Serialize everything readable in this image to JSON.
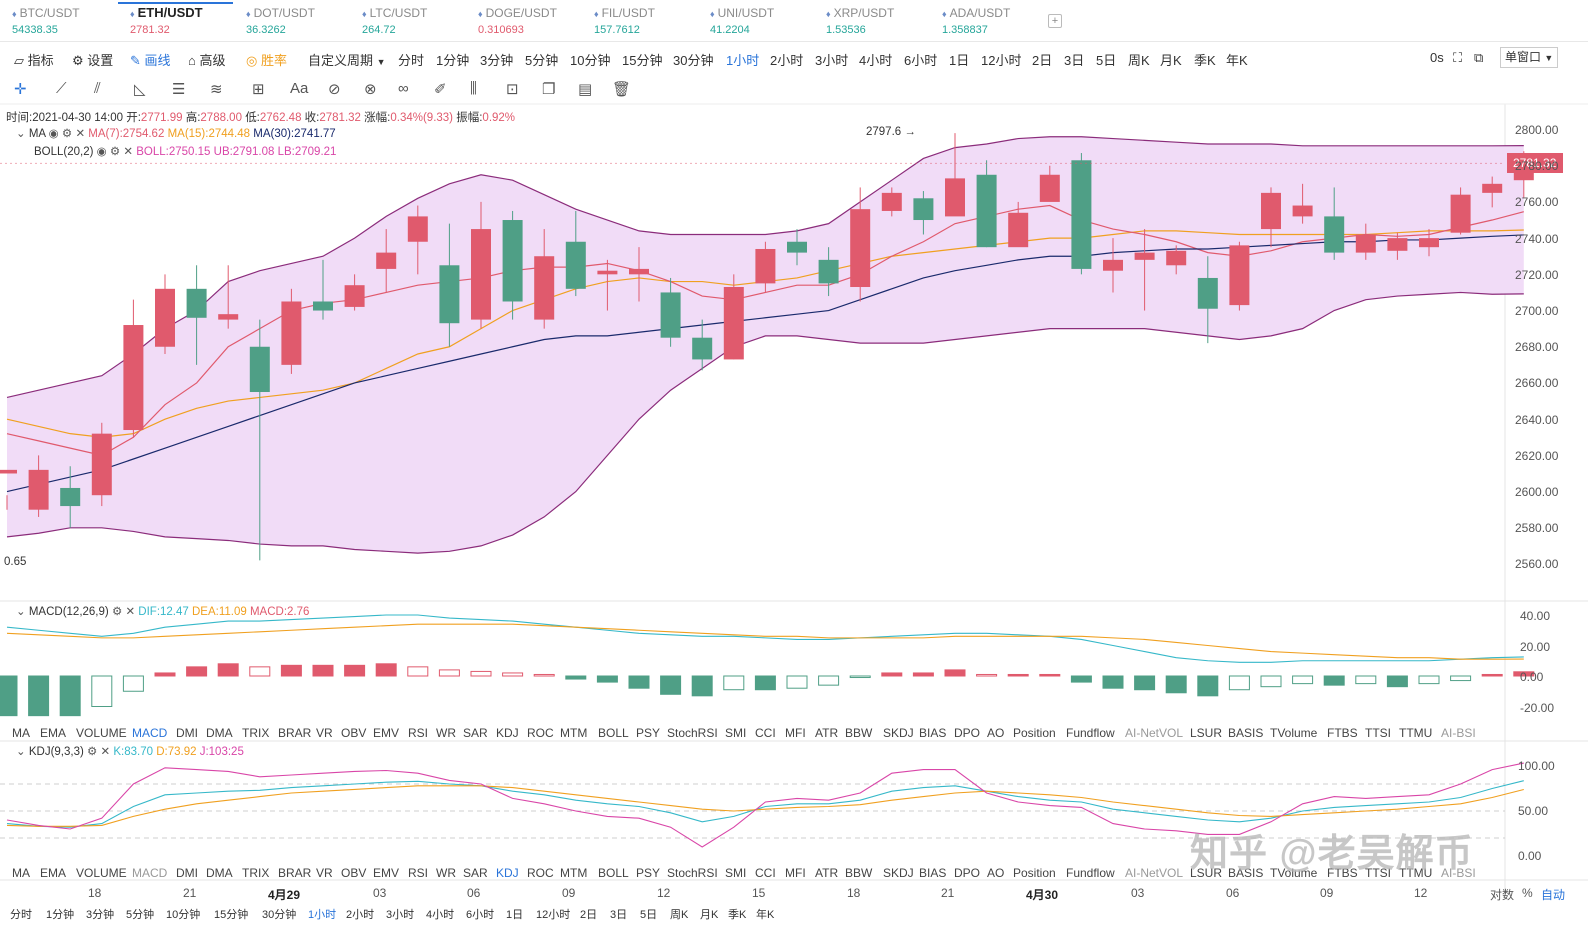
{
  "tabs": [
    {
      "symbol": "BTC/USDT",
      "price": "54338.35",
      "dir": "up"
    },
    {
      "symbol": "ETH/USDT",
      "price": "2781.32",
      "dir": "down",
      "active": true
    },
    {
      "symbol": "DOT/USDT",
      "price": "36.3262",
      "dir": "up"
    },
    {
      "symbol": "LTC/USDT",
      "price": "264.72",
      "dir": "up"
    },
    {
      "symbol": "DOGE/USDT",
      "price": "0.310693",
      "dir": "down"
    },
    {
      "symbol": "FIL/USDT",
      "price": "157.7612",
      "dir": "up"
    },
    {
      "symbol": "UNI/USDT",
      "price": "41.2204",
      "dir": "up"
    },
    {
      "symbol": "XRP/USDT",
      "price": "1.53536",
      "dir": "up"
    },
    {
      "symbol": "ADA/USDT",
      "price": "1.358837",
      "dir": "up"
    }
  ],
  "add_tab": "+",
  "toolbar": {
    "indicator": "指标",
    "settings": "设置",
    "draw": "画线",
    "advanced": "高级",
    "winrate": "胜率",
    "custom_period": "自定义周期",
    "periods": [
      "分时",
      "1分钟",
      "3分钟",
      "5分钟",
      "10分钟",
      "15分钟",
      "30分钟",
      "1小时",
      "2小时",
      "3小时",
      "4小时",
      "6小时",
      "1日",
      "12小时",
      "2日",
      "3日",
      "5日",
      "周K",
      "月K",
      "季K",
      "年K"
    ],
    "active_period": "1小时",
    "latency": "0s",
    "window_mode": "单窗口"
  },
  "ohlc": {
    "time_label": "时间:",
    "time": "2021-04-30 14:00",
    "open_label": "开:",
    "open": "2771.99",
    "high_label": "高:",
    "high": "2788.00",
    "low_label": "低:",
    "low": "2762.48",
    "close_label": "收:",
    "close": "2781.32",
    "change_label": "涨幅:",
    "change": "0.34%(9.33)",
    "amp_label": "振幅:",
    "amp": "0.92%"
  },
  "ma": {
    "name": "MA",
    "ma7": "MA(7):2754.62",
    "ma15": "MA(15):2744.48",
    "ma30": "MA(30):2741.77"
  },
  "boll": {
    "name": "BOLL(20,2)",
    "mid": "BOLL:2750.15",
    "ub": "UB:2791.08",
    "lb": "LB:2709.21"
  },
  "macd_info": {
    "name": "MACD(12,26,9)",
    "dif": "DIF:12.47",
    "dea": "DEA:11.09",
    "macd": "MACD:2.76"
  },
  "kdj_info": {
    "name": "KDJ(9,3,3)",
    "k": "K:83.70",
    "d": "D:73.92",
    "j": "J:103:25"
  },
  "indicator_tabs": [
    "MA",
    "EMA",
    "VOLUME",
    "MACD",
    "DMI",
    "DMA",
    "TRIX",
    "BRAR",
    "VR",
    "OBV",
    "EMV",
    "RSI",
    "WR",
    "SAR",
    "KDJ",
    "ROC",
    "MTM",
    "BOLL",
    "PSY",
    "StochRSI",
    "SMI",
    "CCI",
    "MFI",
    "ATR",
    "BBW",
    "SKDJ",
    "BIAS",
    "DPO",
    "AO",
    "Position",
    "Fundflow",
    "AI-NetVOL",
    "LSUR",
    "BASIS",
    "TVolume",
    "FTBS",
    "TTSI",
    "TTMU",
    "AI-BSI"
  ],
  "high_marker": "2797.6 →",
  "low_marker": "0.65",
  "last_price_tag": "2781.32",
  "price_axis": [
    "2800.00",
    "2780.00",
    "2760.00",
    "2740.00",
    "2720.00",
    "2700.00",
    "2680.00",
    "2660.00",
    "2640.00",
    "2620.00",
    "2600.00",
    "2580.00",
    "2560.00"
  ],
  "macd_axis": [
    "40.00",
    "20.00",
    "0.00",
    "-20.00"
  ],
  "kdj_axis": [
    "100.00",
    "50.00",
    "0.00"
  ],
  "time_axis": [
    "18",
    "21",
    "4月29",
    "03",
    "06",
    "09",
    "12",
    "15",
    "18",
    "21",
    "4月30",
    "03",
    "06",
    "09",
    "12"
  ],
  "axis_controls": {
    "log": "对数",
    "pct": "%",
    "auto": "自动"
  },
  "bottom_periods": [
    "分时",
    "1分钟",
    "3分钟",
    "5分钟",
    "10分钟",
    "15分钟",
    "30分钟",
    "1小时",
    "2小时",
    "3小时",
    "4小时",
    "6小时",
    "1日",
    "12小时",
    "2日",
    "3日",
    "5日",
    "周K",
    "月K",
    "季K",
    "年K"
  ],
  "watermark": "知乎 @老吴解币",
  "colors": {
    "up": "#e05a6d",
    "down": "#4f9f86",
    "band": "#f1dcf7",
    "band_line": "#8b2c7b",
    "ma7": "#e05a6d",
    "ma15": "#f0a020",
    "ma30": "#1a2a6c",
    "accent": "#2a74d9"
  },
  "chart_data": {
    "type": "candlestick",
    "interval": "1h",
    "price_range": [
      2548,
      2808
    ],
    "candles": [
      [
        2610,
        2612,
        2598,
        2590
      ],
      [
        2590,
        2612,
        2620,
        2586
      ],
      [
        2602,
        2592,
        2614,
        2580
      ],
      [
        2598,
        2632,
        2638,
        2592
      ],
      [
        2634,
        2692,
        2706,
        2630
      ],
      [
        2680,
        2712,
        2720,
        2676
      ],
      [
        2712,
        2696,
        2725,
        2670
      ],
      [
        2695,
        2698,
        2725,
        2690
      ],
      [
        2680,
        2655,
        2695,
        2562
      ],
      [
        2670,
        2705,
        2712,
        2665
      ],
      [
        2705,
        2700,
        2728,
        2695
      ],
      [
        2702,
        2714,
        2720,
        2700
      ],
      [
        2723,
        2732,
        2745,
        2710
      ],
      [
        2738,
        2752,
        2758,
        2720
      ],
      [
        2725,
        2693,
        2748,
        2680
      ],
      [
        2695,
        2745,
        2760,
        2690
      ],
      [
        2750,
        2705,
        2755,
        2695
      ],
      [
        2695,
        2730,
        2745,
        2690
      ],
      [
        2738,
        2712,
        2755,
        2708
      ],
      [
        2720,
        2722,
        2728,
        2700
      ],
      [
        2720,
        2723,
        2735,
        2705
      ],
      [
        2710,
        2685,
        2718,
        2680
      ],
      [
        2685,
        2673,
        2695,
        2667
      ],
      [
        2673,
        2713,
        2720,
        2673
      ],
      [
        2715,
        2734,
        2738,
        2710
      ],
      [
        2738,
        2732,
        2745,
        2725
      ],
      [
        2728,
        2715,
        2735,
        2708
      ],
      [
        2713,
        2756,
        2768,
        2705
      ],
      [
        2755,
        2765,
        2768,
        2752
      ],
      [
        2762,
        2750,
        2766,
        2742
      ],
      [
        2752,
        2773,
        2798,
        2755
      ],
      [
        2775,
        2735,
        2783,
        2735
      ],
      [
        2735,
        2754,
        2760,
        2742
      ],
      [
        2760,
        2775,
        2780,
        2762
      ],
      [
        2783,
        2723,
        2787,
        2720
      ],
      [
        2722,
        2728,
        2740,
        2710
      ],
      [
        2728,
        2732,
        2745,
        2700
      ],
      [
        2725,
        2733,
        2736,
        2720
      ],
      [
        2718,
        2701,
        2730,
        2682
      ],
      [
        2703,
        2736,
        2738,
        2700
      ],
      [
        2745,
        2765,
        2768,
        2735
      ],
      [
        2752,
        2758,
        2770,
        2748
      ],
      [
        2752,
        2732,
        2768,
        2728
      ],
      [
        2732,
        2742,
        2748,
        2728
      ],
      [
        2733,
        2740,
        2743,
        2728
      ],
      [
        2735,
        2740,
        2745,
        2730
      ],
      [
        2743,
        2764,
        2768,
        2742
      ],
      [
        2765,
        2770,
        2774,
        2757
      ],
      [
        2771.99,
        2781.32,
        2788,
        2762.48
      ]
    ],
    "ma7": [
      2632,
      2628,
      2624,
      2620,
      2630,
      2648,
      2660,
      2680,
      2690,
      2700,
      2704,
      2706,
      2710,
      2714,
      2716,
      2718,
      2722,
      2724,
      2724,
      2726,
      2722,
      2716,
      2708,
      2706,
      2710,
      2714,
      2714,
      2720,
      2730,
      2738,
      2748,
      2752,
      2756,
      2758,
      2750,
      2745,
      2742,
      2738,
      2732,
      2730,
      2733,
      2738,
      2740,
      2742,
      2741,
      2742,
      2746,
      2750,
      2754.62
    ],
    "ma15": [
      2640,
      2636,
      2632,
      2630,
      2632,
      2640,
      2646,
      2650,
      2652,
      2654,
      2656,
      2660,
      2668,
      2676,
      2680,
      2690,
      2700,
      2706,
      2712,
      2716,
      2718,
      2716,
      2716,
      2714,
      2716,
      2718,
      2722,
      2726,
      2730,
      2732,
      2734,
      2736,
      2738,
      2740,
      2740,
      2742,
      2744,
      2744,
      2743,
      2742,
      2742,
      2742,
      2742,
      2742,
      2743,
      2744,
      2744,
      2744,
      2744.48
    ],
    "ma30": [
      2600,
      2604,
      2608,
      2612,
      2618,
      2624,
      2630,
      2636,
      2642,
      2648,
      2654,
      2660,
      2664,
      2668,
      2672,
      2676,
      2680,
      2684,
      2686,
      2686,
      2688,
      2690,
      2692,
      2694,
      2696,
      2698,
      2700,
      2706,
      2712,
      2718,
      2722,
      2725,
      2728,
      2730,
      2730,
      2732,
      2733,
      2734,
      2734,
      2735,
      2736,
      2737,
      2738,
      2738,
      2739,
      2739,
      2740,
      2741,
      2741.77
    ],
    "boll_ub": [
      2652,
      2656,
      2660,
      2664,
      2676,
      2690,
      2700,
      2716,
      2722,
      2726,
      2730,
      2740,
      2752,
      2762,
      2770,
      2775,
      2772,
      2764,
      2756,
      2750,
      2744,
      2742,
      2742,
      2742,
      2742,
      2744,
      2748,
      2760,
      2772,
      2784,
      2790,
      2792,
      2795,
      2796,
      2796,
      2795,
      2794,
      2793,
      2792,
      2792,
      2792,
      2791,
      2791,
      2791,
      2791,
      2791,
      2791,
      2791,
      2791.08
    ],
    "boll_mid": [],
    "boll_lb": [
      2575,
      2577,
      2580,
      2580,
      2578,
      2575,
      2574,
      2573,
      2571,
      2570,
      2570,
      2568,
      2567,
      2566,
      2567,
      2570,
      2576,
      2586,
      2600,
      2620,
      2640,
      2656,
      2668,
      2680,
      2686,
      2686,
      2684,
      2682,
      2682,
      2682,
      2684,
      2686,
      2688,
      2690,
      2690,
      2690,
      2690,
      2688,
      2686,
      2684,
      2686,
      2690,
      2700,
      2706,
      2708,
      2709,
      2710,
      2709,
      2709.21
    ],
    "macd": {
      "dif": [
        32,
        30,
        28,
        26,
        28,
        32,
        34,
        36,
        36,
        37,
        38,
        39,
        40,
        40,
        38,
        37,
        36,
        34,
        32,
        30,
        28,
        27,
        26,
        26,
        25,
        24,
        24,
        25,
        26,
        27,
        28,
        28,
        27,
        26,
        24,
        20,
        16,
        12,
        10,
        9,
        9,
        10,
        10,
        10,
        10,
        10,
        11,
        12,
        12.47
      ],
      "dea": [
        28,
        27,
        26,
        25,
        25,
        26,
        27,
        28,
        29,
        30,
        31,
        32,
        33,
        34,
        34,
        34,
        34,
        33,
        32,
        31,
        30,
        29,
        28,
        27,
        26,
        26,
        25,
        25,
        25,
        25,
        26,
        26,
        26,
        26,
        26,
        25,
        24,
        22,
        20,
        18,
        16,
        15,
        14,
        13,
        12,
        12,
        11,
        11,
        11.09
      ],
      "hist": [
        -26,
        -26,
        -26,
        -20,
        -10,
        2,
        6,
        8,
        6,
        7,
        7,
        7,
        8,
        6,
        4,
        3,
        2,
        1,
        -2,
        -4,
        -8,
        -12,
        -13,
        -9,
        -9,
        -8,
        -6,
        -1,
        2,
        2,
        4,
        1,
        1,
        1,
        -4,
        -8,
        -9,
        -11,
        -13,
        -9,
        -7,
        -5,
        -6,
        -5,
        -7,
        -5,
        -3,
        1,
        2.76
      ]
    },
    "kdj": {
      "k": [
        36,
        33,
        32,
        36,
        55,
        68,
        70,
        72,
        73,
        76,
        78,
        80,
        82,
        83,
        80,
        78,
        72,
        68,
        62,
        58,
        55,
        48,
        38,
        44,
        55,
        58,
        58,
        62,
        72,
        76,
        78,
        72,
        66,
        62,
        60,
        52,
        48,
        44,
        40,
        38,
        42,
        50,
        54,
        56,
        58,
        60,
        65,
        75,
        83.7
      ],
      "d": [
        34,
        33,
        33,
        34,
        44,
        52,
        58,
        62,
        66,
        70,
        72,
        74,
        76,
        78,
        78,
        78,
        76,
        72,
        68,
        64,
        60,
        56,
        52,
        50,
        52,
        54,
        55,
        57,
        62,
        66,
        70,
        72,
        70,
        68,
        65,
        60,
        56,
        52,
        48,
        45,
        44,
        46,
        48,
        50,
        52,
        55,
        58,
        65,
        73.92
      ],
      "j": [
        40,
        34,
        30,
        42,
        80,
        98,
        96,
        94,
        88,
        90,
        92,
        94,
        95,
        92,
        84,
        80,
        64,
        58,
        50,
        44,
        42,
        32,
        10,
        32,
        60,
        64,
        62,
        70,
        92,
        96,
        96,
        70,
        60,
        56,
        54,
        36,
        30,
        28,
        24,
        24,
        38,
        58,
        66,
        64,
        66,
        68,
        80,
        96,
        103.25
      ]
    }
  }
}
